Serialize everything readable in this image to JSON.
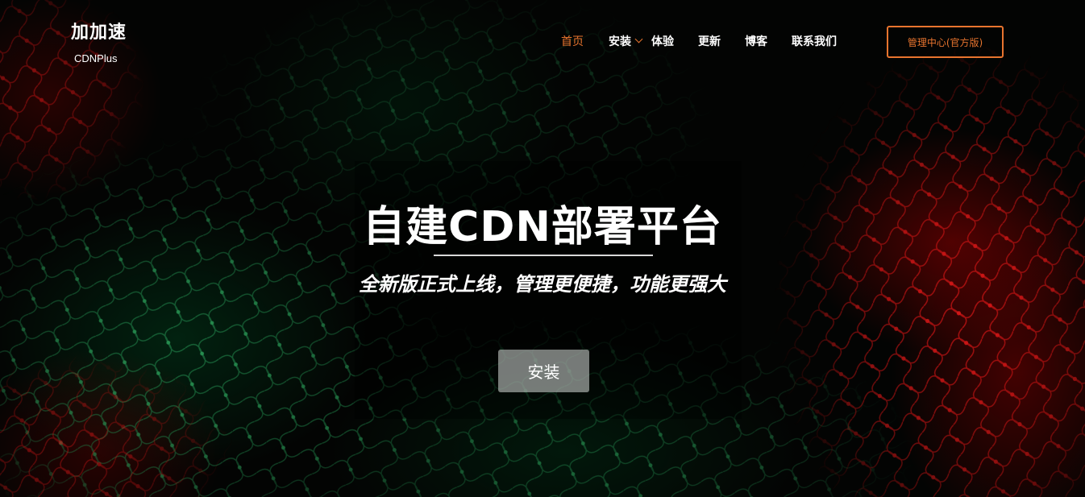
{
  "brand": {
    "title": "加加速",
    "subtitle": "CDNPlus"
  },
  "nav": {
    "items": [
      {
        "label": "首页",
        "active": true
      },
      {
        "label": "安装",
        "has_dropdown": true
      },
      {
        "label": "体验"
      },
      {
        "label": "更新"
      },
      {
        "label": "博客"
      },
      {
        "label": "联系我们"
      }
    ],
    "admin_button": "管理中心(官方版)"
  },
  "hero": {
    "title": "自建CDN部署平台",
    "subtitle": "全新版正式上线，管理更便捷，功能更强大",
    "button": "安装"
  },
  "colors": {
    "accent": "#e8742e",
    "text": "#ffffff",
    "background": "#030403",
    "network_green": "#1f7a45",
    "network_red": "#c41414"
  }
}
